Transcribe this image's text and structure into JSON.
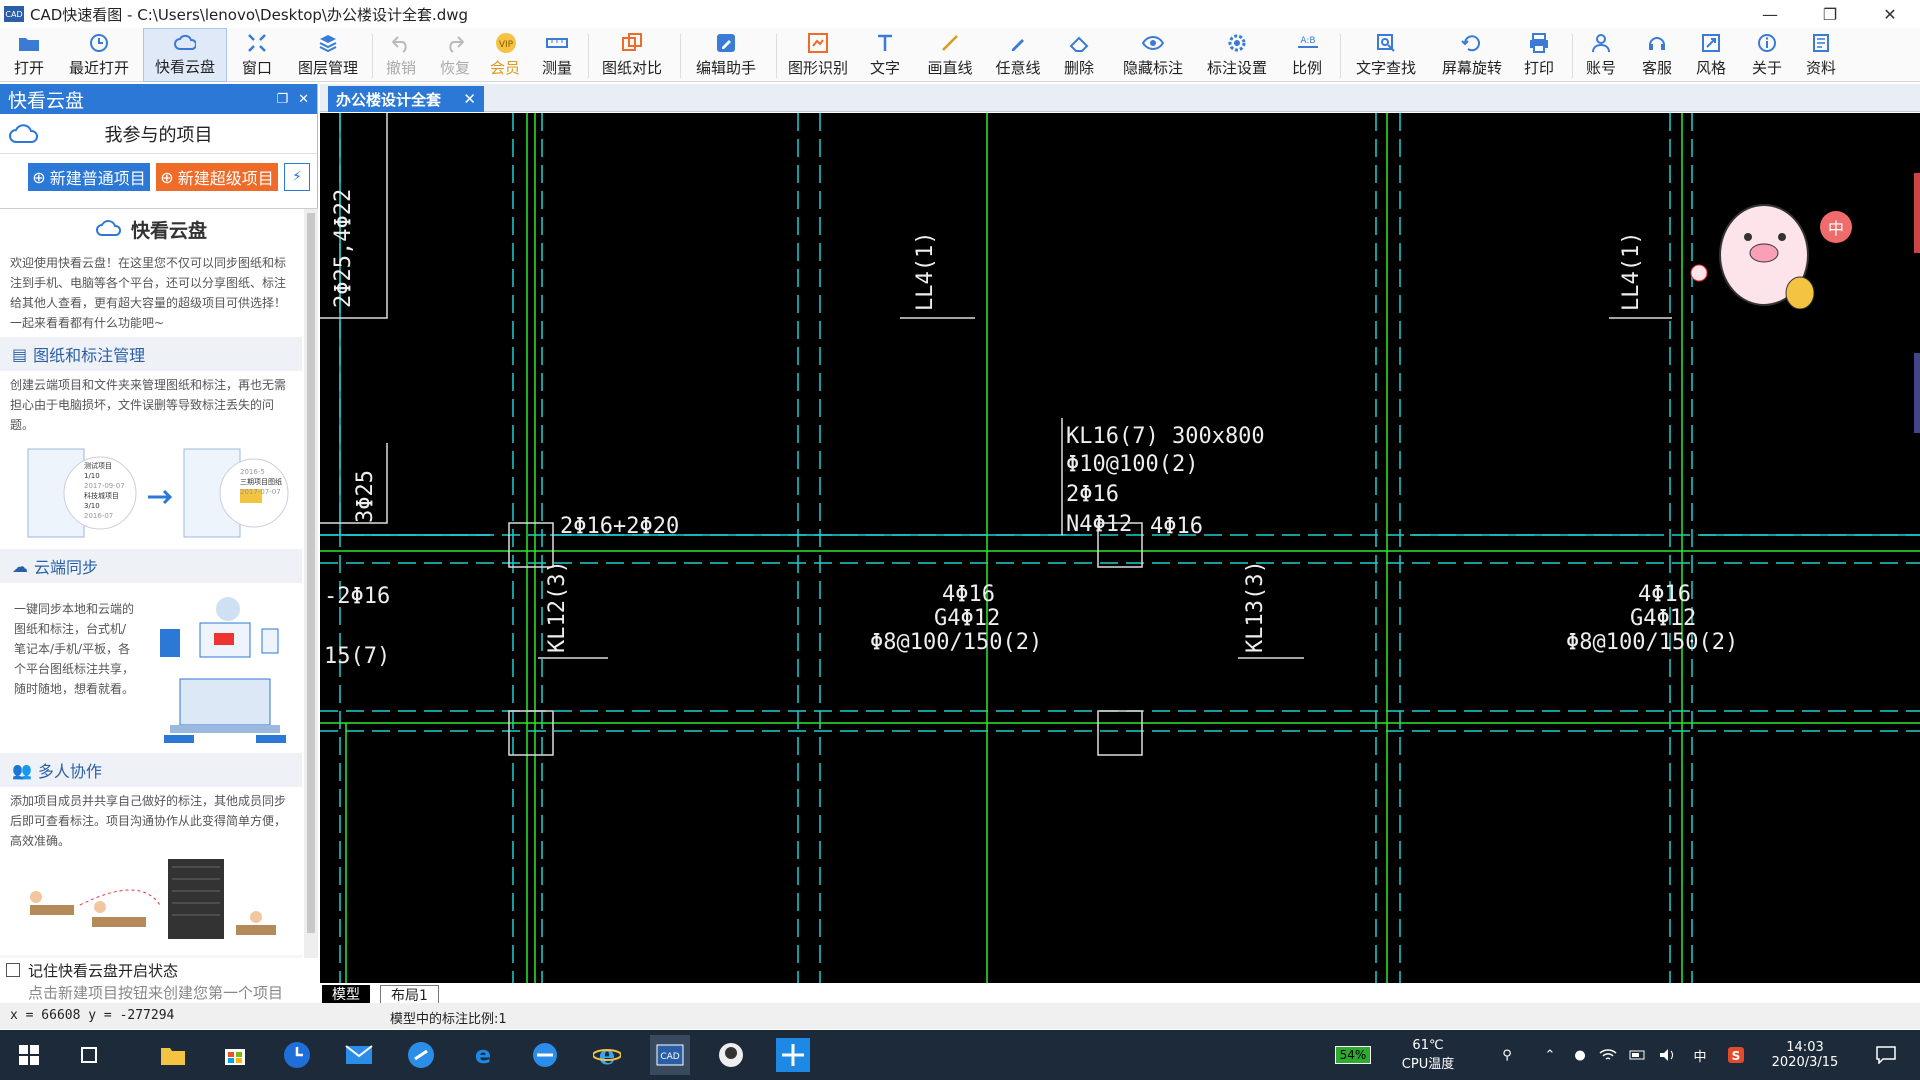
{
  "window": {
    "app_label": "CAD",
    "title": "CAD快速看图 - C:\\Users\\lenovo\\Desktop\\办公楼设计全套.dwg",
    "minimize": "—",
    "maximize": "❐",
    "close": "✕"
  },
  "toolbar": {
    "items": [
      {
        "label": "打开",
        "icon": "folder-icon"
      },
      {
        "label": "最近打开",
        "icon": "clock-icon"
      },
      {
        "label": "快看云盘",
        "icon": "cloud-icon",
        "active": true
      },
      {
        "label": "窗口",
        "icon": "window-icon"
      },
      {
        "label": "图层管理",
        "icon": "layers-icon"
      },
      {
        "label": "撤销",
        "icon": "undo-icon",
        "disabled": true
      },
      {
        "label": "恢复",
        "icon": "redo-icon",
        "disabled": true
      },
      {
        "label": "会员",
        "icon": "vip-icon"
      },
      {
        "label": "测量",
        "icon": "ruler-icon"
      },
      {
        "label": "图纸对比",
        "icon": "compare-icon"
      },
      {
        "label": "编辑助手",
        "icon": "edit-icon"
      },
      {
        "label": "图形识别",
        "icon": "recognize-icon"
      },
      {
        "label": "文字",
        "icon": "text-icon"
      },
      {
        "label": "画直线",
        "icon": "line-icon"
      },
      {
        "label": "任意线",
        "icon": "pen-icon"
      },
      {
        "label": "删除",
        "icon": "eraser-icon"
      },
      {
        "label": "隐藏标注",
        "icon": "eye-icon"
      },
      {
        "label": "标注设置",
        "icon": "settings-icon"
      },
      {
        "label": "比例",
        "icon": "ratio-icon"
      },
      {
        "label": "文字查找",
        "icon": "search-icon"
      },
      {
        "label": "屏幕旋转",
        "icon": "rotate-icon"
      },
      {
        "label": "打印",
        "icon": "printer-icon"
      },
      {
        "label": "账号",
        "icon": "user-icon"
      },
      {
        "label": "客服",
        "icon": "headset-icon"
      },
      {
        "label": "风格",
        "icon": "style-icon"
      },
      {
        "label": "关于",
        "icon": "info-icon"
      },
      {
        "label": "资料",
        "icon": "book-icon"
      }
    ]
  },
  "sidebar": {
    "title": "快看云盘",
    "projects_title": "我参与的项目",
    "new_normal": "新建普通项目",
    "new_super": "新建超级项目",
    "content_title": "快看云盘",
    "intro": "欢迎使用快看云盘！在这里您不仅可以同步图纸和标注到手机、电脑等各个平台，还可以分享图纸、标注给其他人查看，更有超大容量的超级项目可供选择！一起来看看都有什么功能吧~",
    "sections": [
      {
        "title": "图纸和标注管理",
        "text": "创建云端项目和文件夹来管理图纸和标注，再也无需担心由于电脑损坏，文件误删等导致标注丢失的问题。"
      },
      {
        "title": "云端同步",
        "text": "一键同步本地和云端的图纸和标注，台式机/笔记本/手机/平板，各个平台图纸标注共享，随时随地，想看就看。"
      },
      {
        "title": "多人协作",
        "text": "添加项目成员并共享自己做好的标注，其他成员同步后即可查看标注。项目沟通协作从此变得简单方便，高效准确。"
      }
    ],
    "illus1": {
      "a_title": "测试项目",
      "a_date1": "1/10",
      "a_date2": "2017-09-07",
      "a_title2": "科技城项目",
      "a_date3": "3/10",
      "a_date4": "2016-07",
      "b_title": "三期项目图纸",
      "b_date1": "2016-5",
      "b_date2": "2017-07-07"
    },
    "remember": "记住快看云盘开启状态",
    "hint": "点击新建项目按钮来创建您第一个项目"
  },
  "doc_tab": {
    "label": "办公楼设计全套",
    "close": "✕"
  },
  "drawing": {
    "texts": [
      "2Φ25,4Φ22",
      "3Φ25",
      "LL4(1)",
      "LL4(1)",
      "KL16(7) 300x800",
      "Φ10@100(2)",
      "2Φ16",
      "N4Φ12",
      "2Φ16+2Φ20",
      "4Φ16",
      "-2Φ16",
      "15(7)",
      "KL12(3)",
      "4Φ16",
      "G4Φ12",
      "Φ8@100/150(2)",
      "KL13(3)",
      "4Φ16",
      "G4Φ12",
      "Φ8@100/150(2)"
    ],
    "mascot_badge": "中"
  },
  "layout_tabs": {
    "model": "模型",
    "layout1": "布局1"
  },
  "status": {
    "coords": "x = 66608  y = -277294",
    "scale": "模型中的标注比例:1"
  },
  "taskbar": {
    "battery": "54%",
    "temp": "61℃",
    "temp_label": "CPU温度",
    "ime": "中",
    "time": "14:03",
    "date": "2020/3/15"
  }
}
